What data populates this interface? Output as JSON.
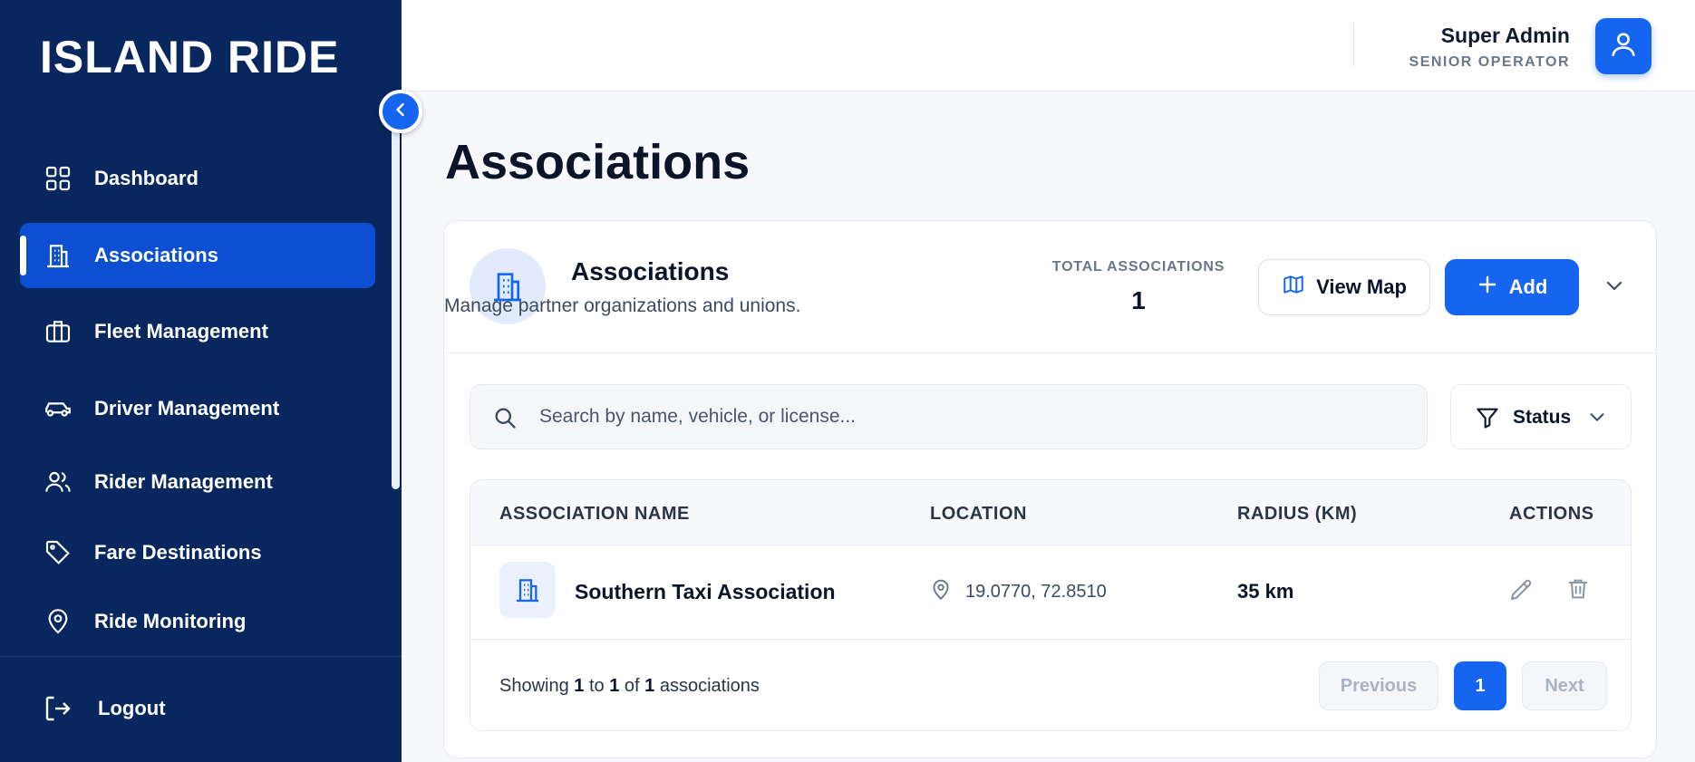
{
  "brand": {
    "logo_text": "ISLAND RIDE"
  },
  "sidebar": {
    "items": [
      {
        "label": "Dashboard",
        "icon": "grid-icon",
        "active": false
      },
      {
        "label": "Associations",
        "icon": "building-icon",
        "active": true
      },
      {
        "label": "Fleet Management",
        "icon": "briefcase-icon",
        "active": false
      },
      {
        "label": "Driver Management",
        "icon": "car-icon",
        "active": false
      },
      {
        "label": "Rider Management",
        "icon": "users-icon",
        "active": false
      },
      {
        "label": "Fare Destinations",
        "icon": "tag-icon",
        "active": false
      },
      {
        "label": "Ride Monitoring",
        "icon": "map-pin-icon",
        "active": false
      }
    ],
    "logout_label": "Logout"
  },
  "header": {
    "user_name": "Super Admin",
    "user_role": "SENIOR OPERATOR"
  },
  "page": {
    "title": "Associations"
  },
  "card": {
    "title": "Associations",
    "subtitle": "Manage partner organizations and unions.",
    "total_label": "TOTAL ASSOCIATIONS",
    "total_value": "1",
    "view_map_label": "View Map",
    "add_label": "Add"
  },
  "filters": {
    "search_placeholder": "Search by name, vehicle, or license...",
    "status_label": "Status"
  },
  "table": {
    "columns": [
      "ASSOCIATION NAME",
      "LOCATION",
      "RADIUS (KM)",
      "ACTIONS"
    ],
    "rows": [
      {
        "name": "Southern Taxi Association",
        "location": "19.0770, 72.8510",
        "radius": "35 km"
      }
    ]
  },
  "pagination": {
    "showing_prefix": "Showing",
    "from": "1",
    "to_word": "to",
    "to": "1",
    "of_word": "of",
    "total": "1",
    "suffix": "associations",
    "previous_label": "Previous",
    "current_page": "1",
    "next_label": "Next"
  },
  "colors": {
    "sidebar_bg": "#08275e",
    "active_item": "#0d4fd3",
    "accent": "#1565f0"
  }
}
